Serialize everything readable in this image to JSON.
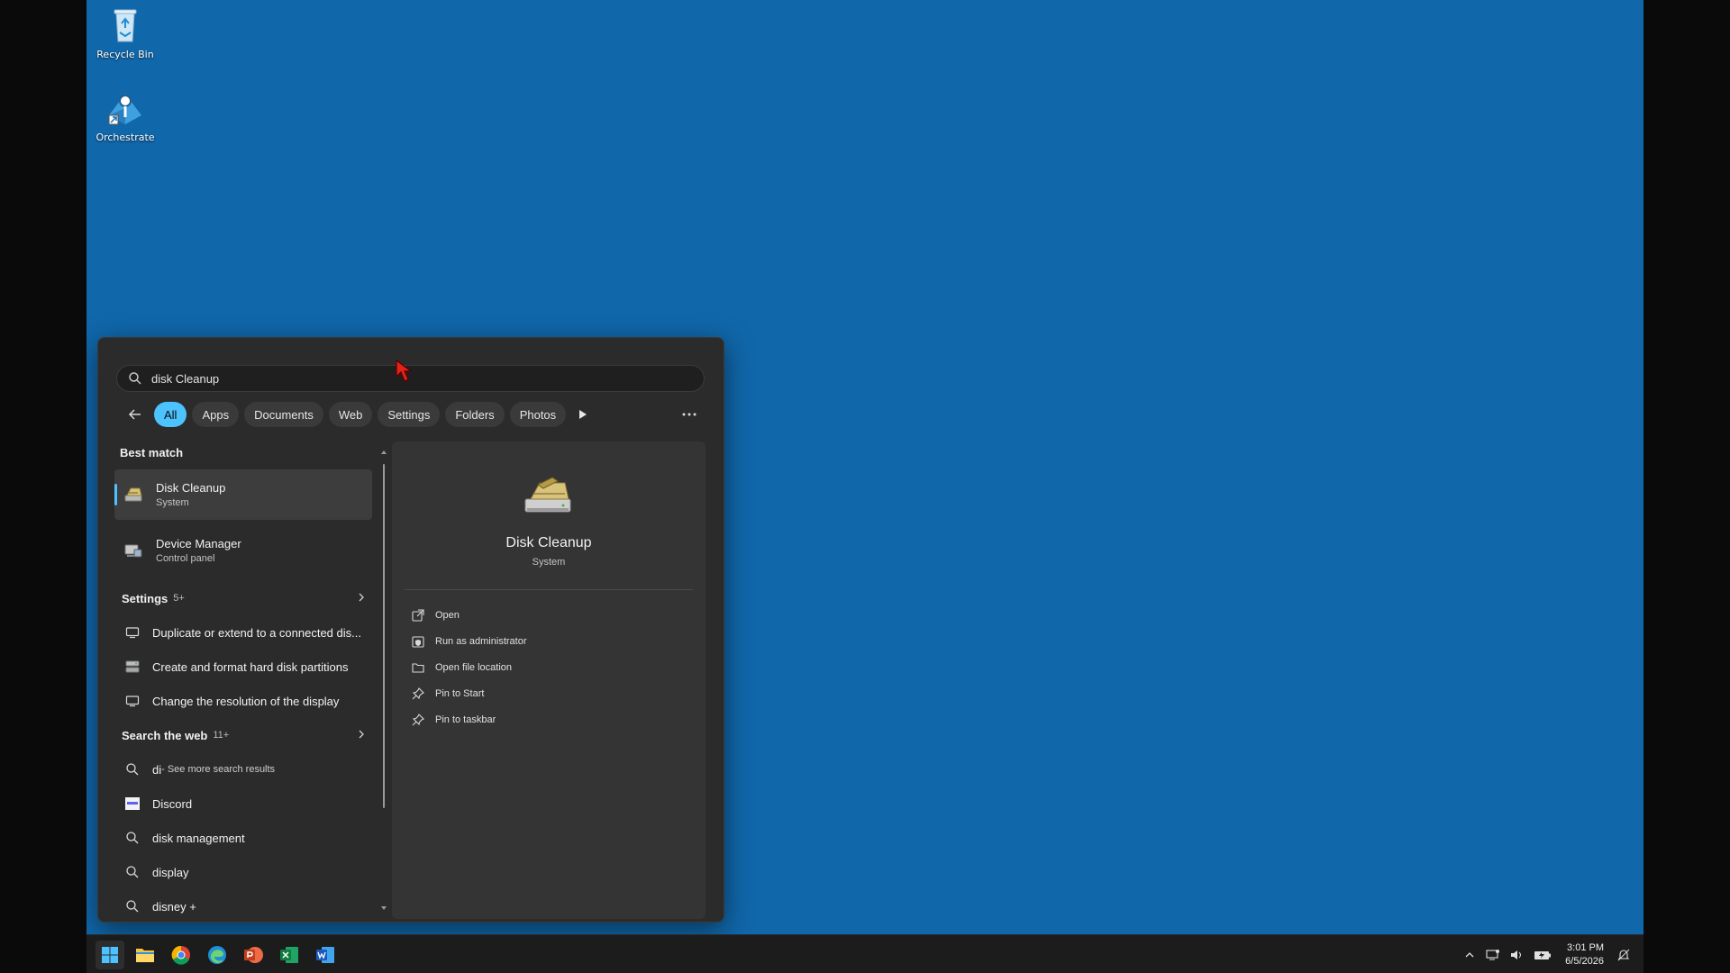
{
  "desktop": {
    "icons": [
      {
        "label": "Recycle Bin",
        "icon": "recycle-bin-icon"
      },
      {
        "label": "Orchestrate",
        "icon": "orchestrate-icon"
      }
    ]
  },
  "search": {
    "query": "disk Cleanup",
    "filters": [
      "All",
      "Apps",
      "Documents",
      "Web",
      "Settings",
      "Folders",
      "Photos"
    ],
    "active_filter": "All",
    "more_label": "···"
  },
  "results": {
    "best_match_title": "Best match",
    "best_match": {
      "title": "Disk Cleanup",
      "subtitle": "System"
    },
    "device_manager": {
      "title": "Device Manager",
      "subtitle": "Control panel"
    },
    "settings_title": "Settings",
    "settings_count": "5+",
    "settings_items": [
      "Duplicate or extend to a connected dis...",
      "Create and format hard disk partitions",
      "Change the resolution of the display"
    ],
    "web_title": "Search the web",
    "web_count": "11+",
    "web_first_query": "di",
    "web_first_suffix": " - See more search results",
    "web_items": [
      "Discord",
      "disk management",
      "display",
      "disney +"
    ]
  },
  "preview": {
    "title": "Disk Cleanup",
    "subtitle": "System",
    "actions": [
      "Open",
      "Run as administrator",
      "Open file location",
      "Pin to Start",
      "Pin to taskbar"
    ]
  },
  "taskbar": {
    "apps": [
      "start-icon",
      "file-explorer-icon",
      "chrome-icon",
      "edge-icon",
      "powerpoint-icon",
      "excel-icon",
      "word-icon"
    ],
    "time": "3:01 PM",
    "date": "6/5/2026"
  }
}
